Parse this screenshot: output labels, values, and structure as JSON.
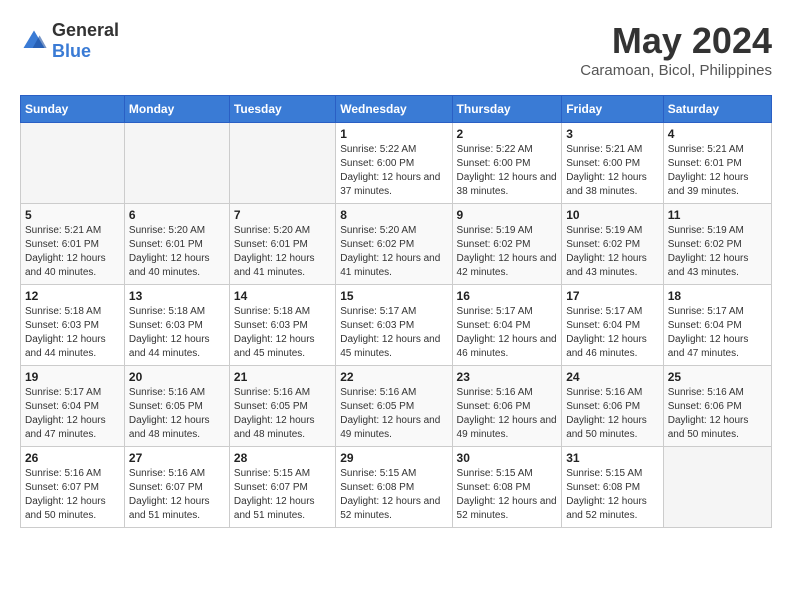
{
  "logo": {
    "text_general": "General",
    "text_blue": "Blue"
  },
  "title": {
    "month_year": "May 2024",
    "location": "Caramoan, Bicol, Philippines"
  },
  "days_of_week": [
    "Sunday",
    "Monday",
    "Tuesday",
    "Wednesday",
    "Thursday",
    "Friday",
    "Saturday"
  ],
  "weeks": [
    [
      {
        "day": "",
        "info": ""
      },
      {
        "day": "",
        "info": ""
      },
      {
        "day": "",
        "info": ""
      },
      {
        "day": "1",
        "info": "Sunrise: 5:22 AM\nSunset: 6:00 PM\nDaylight: 12 hours and 37 minutes."
      },
      {
        "day": "2",
        "info": "Sunrise: 5:22 AM\nSunset: 6:00 PM\nDaylight: 12 hours and 38 minutes."
      },
      {
        "day": "3",
        "info": "Sunrise: 5:21 AM\nSunset: 6:00 PM\nDaylight: 12 hours and 38 minutes."
      },
      {
        "day": "4",
        "info": "Sunrise: 5:21 AM\nSunset: 6:01 PM\nDaylight: 12 hours and 39 minutes."
      }
    ],
    [
      {
        "day": "5",
        "info": "Sunrise: 5:21 AM\nSunset: 6:01 PM\nDaylight: 12 hours and 40 minutes."
      },
      {
        "day": "6",
        "info": "Sunrise: 5:20 AM\nSunset: 6:01 PM\nDaylight: 12 hours and 40 minutes."
      },
      {
        "day": "7",
        "info": "Sunrise: 5:20 AM\nSunset: 6:01 PM\nDaylight: 12 hours and 41 minutes."
      },
      {
        "day": "8",
        "info": "Sunrise: 5:20 AM\nSunset: 6:02 PM\nDaylight: 12 hours and 41 minutes."
      },
      {
        "day": "9",
        "info": "Sunrise: 5:19 AM\nSunset: 6:02 PM\nDaylight: 12 hours and 42 minutes."
      },
      {
        "day": "10",
        "info": "Sunrise: 5:19 AM\nSunset: 6:02 PM\nDaylight: 12 hours and 43 minutes."
      },
      {
        "day": "11",
        "info": "Sunrise: 5:19 AM\nSunset: 6:02 PM\nDaylight: 12 hours and 43 minutes."
      }
    ],
    [
      {
        "day": "12",
        "info": "Sunrise: 5:18 AM\nSunset: 6:03 PM\nDaylight: 12 hours and 44 minutes."
      },
      {
        "day": "13",
        "info": "Sunrise: 5:18 AM\nSunset: 6:03 PM\nDaylight: 12 hours and 44 minutes."
      },
      {
        "day": "14",
        "info": "Sunrise: 5:18 AM\nSunset: 6:03 PM\nDaylight: 12 hours and 45 minutes."
      },
      {
        "day": "15",
        "info": "Sunrise: 5:17 AM\nSunset: 6:03 PM\nDaylight: 12 hours and 45 minutes."
      },
      {
        "day": "16",
        "info": "Sunrise: 5:17 AM\nSunset: 6:04 PM\nDaylight: 12 hours and 46 minutes."
      },
      {
        "day": "17",
        "info": "Sunrise: 5:17 AM\nSunset: 6:04 PM\nDaylight: 12 hours and 46 minutes."
      },
      {
        "day": "18",
        "info": "Sunrise: 5:17 AM\nSunset: 6:04 PM\nDaylight: 12 hours and 47 minutes."
      }
    ],
    [
      {
        "day": "19",
        "info": "Sunrise: 5:17 AM\nSunset: 6:04 PM\nDaylight: 12 hours and 47 minutes."
      },
      {
        "day": "20",
        "info": "Sunrise: 5:16 AM\nSunset: 6:05 PM\nDaylight: 12 hours and 48 minutes."
      },
      {
        "day": "21",
        "info": "Sunrise: 5:16 AM\nSunset: 6:05 PM\nDaylight: 12 hours and 48 minutes."
      },
      {
        "day": "22",
        "info": "Sunrise: 5:16 AM\nSunset: 6:05 PM\nDaylight: 12 hours and 49 minutes."
      },
      {
        "day": "23",
        "info": "Sunrise: 5:16 AM\nSunset: 6:06 PM\nDaylight: 12 hours and 49 minutes."
      },
      {
        "day": "24",
        "info": "Sunrise: 5:16 AM\nSunset: 6:06 PM\nDaylight: 12 hours and 50 minutes."
      },
      {
        "day": "25",
        "info": "Sunrise: 5:16 AM\nSunset: 6:06 PM\nDaylight: 12 hours and 50 minutes."
      }
    ],
    [
      {
        "day": "26",
        "info": "Sunrise: 5:16 AM\nSunset: 6:07 PM\nDaylight: 12 hours and 50 minutes."
      },
      {
        "day": "27",
        "info": "Sunrise: 5:16 AM\nSunset: 6:07 PM\nDaylight: 12 hours and 51 minutes."
      },
      {
        "day": "28",
        "info": "Sunrise: 5:15 AM\nSunset: 6:07 PM\nDaylight: 12 hours and 51 minutes."
      },
      {
        "day": "29",
        "info": "Sunrise: 5:15 AM\nSunset: 6:08 PM\nDaylight: 12 hours and 52 minutes."
      },
      {
        "day": "30",
        "info": "Sunrise: 5:15 AM\nSunset: 6:08 PM\nDaylight: 12 hours and 52 minutes."
      },
      {
        "day": "31",
        "info": "Sunrise: 5:15 AM\nSunset: 6:08 PM\nDaylight: 12 hours and 52 minutes."
      },
      {
        "day": "",
        "info": ""
      }
    ]
  ]
}
